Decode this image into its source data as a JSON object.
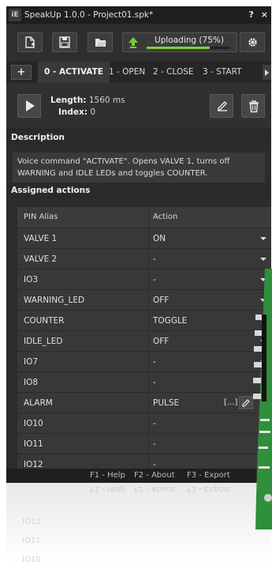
{
  "titlebar": {
    "title": "SpeakUp 1.0.0 - Project01.spk*",
    "help": "?",
    "close": "×",
    "logo": "iE"
  },
  "toolbar": {
    "new_icon": "new-file-icon",
    "save_icon": "save-icon",
    "open_icon": "open-folder-icon",
    "upload_label": "Uploading (75%)",
    "upload_progress": 0.75,
    "settings_icon": "gear-icon"
  },
  "tabs": {
    "add": "+",
    "items": [
      {
        "label": "0 - ACTIVATE",
        "active": true
      },
      {
        "label": "1 - OPEN",
        "active": false
      },
      {
        "label": "2 - CLOSE",
        "active": false
      },
      {
        "label": "3 - START",
        "active": false
      }
    ]
  },
  "command": {
    "length_label": "Length:",
    "length_value": "1560 ms",
    "index_label": "Index:",
    "index_value": "0"
  },
  "description": {
    "heading": "Description",
    "text": "Voice command \"ACTIVATE\". Opens VALVE 1, turns off WARNING and IDLE LEDs and toggles COUNTER."
  },
  "actions": {
    "heading": "Assigned actions",
    "col_pin": "PIN Alias",
    "col_action": "Action",
    "rows": [
      {
        "pin": "VALVE 1",
        "action": "ON"
      },
      {
        "pin": "VALVE 2",
        "action": "-"
      },
      {
        "pin": "IO3",
        "action": "-"
      },
      {
        "pin": "WARNING_LED",
        "action": "OFF"
      },
      {
        "pin": "COUNTER",
        "action": "TOGGLE"
      },
      {
        "pin": "IDLE_LED",
        "action": "OFF"
      },
      {
        "pin": "IO7",
        "action": "-"
      },
      {
        "pin": "IO8",
        "action": "-"
      },
      {
        "pin": "ALARM",
        "action": "PULSE",
        "extra": "[...]"
      },
      {
        "pin": "IO10",
        "action": "-"
      },
      {
        "pin": "IO11",
        "action": "-"
      },
      {
        "pin": "IO12",
        "action": "-"
      }
    ]
  },
  "footer": {
    "help": "F1 - Help",
    "about": "F2 - About",
    "export": "F3 - Export"
  },
  "reflection": {
    "lines": [
      "IO12",
      "IO11",
      "IO10"
    ]
  },
  "colors": {
    "progress": "#7bd23a",
    "upload_arrow": "#6fd12a",
    "board": "#2f8f3a"
  }
}
